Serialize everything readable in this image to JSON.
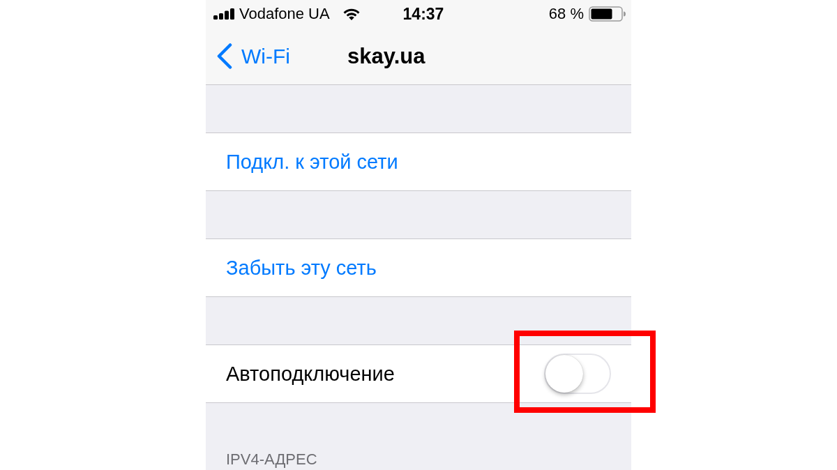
{
  "status_bar": {
    "carrier": "Vodafone UA",
    "time": "14:37",
    "battery": "68 %"
  },
  "nav_bar": {
    "back": "Wi-Fi",
    "title": "skay.ua"
  },
  "sections": [
    {
      "rows": [
        {
          "kind": "action",
          "label": "Подкл. к этой сети"
        }
      ]
    },
    {
      "rows": [
        {
          "kind": "action",
          "label": "Забыть эту сеть"
        }
      ]
    },
    {
      "rows": [
        {
          "kind": "toggle",
          "label": "Автоподключение",
          "on": false,
          "highlighted": true
        }
      ]
    },
    {
      "header": "IPV4-АДРЕС"
    }
  ]
}
